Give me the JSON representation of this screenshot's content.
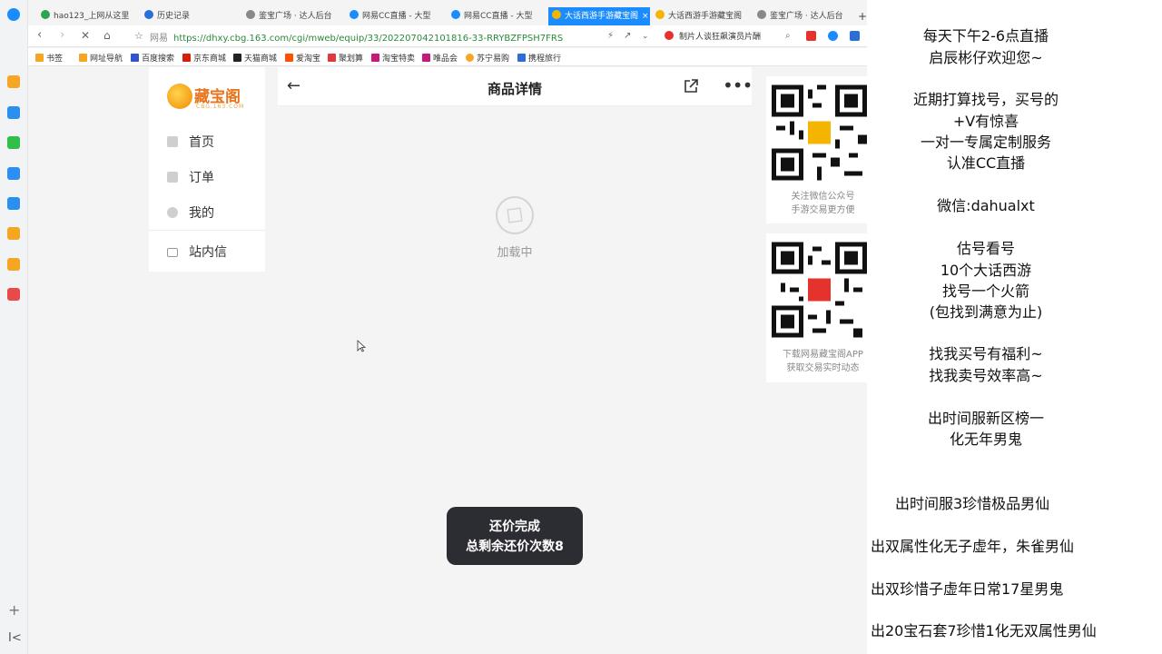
{
  "tabs": [
    {
      "title": "hao123_上网从这里",
      "icon_color": "#2ea44f"
    },
    {
      "title": "历史记录",
      "icon_color": "#2b6fd6"
    },
    {
      "title": "鉴宝广场 · 达人后台",
      "icon_color": "#666666"
    },
    {
      "title": "网易CC直播 - 大型",
      "icon_color": "#1a8cff"
    },
    {
      "title": "网易CC直播 - 大型",
      "icon_color": "#1a8cff"
    },
    {
      "title": "大话西游手游藏宝阁",
      "icon_color": "#f5b400",
      "active": true,
      "close": "×"
    },
    {
      "title": "大话西游手游藏宝阁",
      "icon_color": "#f5b400"
    },
    {
      "title": "鉴宝广场 · 达人后台",
      "icon_color": "#666666"
    },
    {
      "title": "+"
    }
  ],
  "address": {
    "site": "网易",
    "url": "https://dhxy.cbg.163.com/cgi/mweb/equip/33/202207042101816-33-RRYBZFPSH7FRS",
    "right_text": "制片人谈狂飙演员片酬"
  },
  "bookmarks": [
    {
      "label": "书签",
      "icon_color": "#f5a623"
    },
    {
      "label": "网址导航",
      "icon_color": "#f5a623"
    },
    {
      "label": "百度搜索",
      "icon_color": "#3355cc"
    },
    {
      "label": "京东商城",
      "icon_color": "#d81e06"
    },
    {
      "label": "天猫商城",
      "icon_color": "#222222"
    },
    {
      "label": "爱淘宝",
      "icon_color": "#ff5000"
    },
    {
      "label": "聚划算",
      "icon_color": "#e4393c"
    },
    {
      "label": "淘宝特卖",
      "icon_color": "#c7197b"
    },
    {
      "label": "唯品会",
      "icon_color": "#c7197b"
    },
    {
      "label": "苏宁易购",
      "icon_color": "#f5a623"
    },
    {
      "label": "携程旅行",
      "icon_color": "#2b6fd6"
    }
  ],
  "sidebar": {
    "logo_text": "藏宝阁",
    "logo_sub": "CBG.163.COM",
    "items": [
      {
        "label": "首页",
        "icon": "home-icon"
      },
      {
        "label": "订单",
        "icon": "order-icon"
      },
      {
        "label": "我的",
        "icon": "user-icon"
      },
      {
        "label": "站内信",
        "icon": "mail-icon"
      }
    ]
  },
  "content": {
    "back": "←",
    "title": "商品详情",
    "more": "•••",
    "loading": "加载中"
  },
  "toast": {
    "line1": "还价完成",
    "line2": "总剩余还价次数8"
  },
  "qr": [
    {
      "caption1": "关注微信公众号",
      "caption2": "手游交易更方便"
    },
    {
      "caption1": "下载网易藏宝阁APP",
      "caption2": "获取交易实时动态"
    }
  ],
  "side_panel": {
    "lines": [
      "每天下午2-6点直播",
      "启辰彬仔欢迎您~",
      "近期打算找号，买号的",
      "+V有惊喜",
      "一对一专属定制服务",
      "认准CC直播",
      "微信:dahualxt",
      "估号看号",
      "10个大话西游",
      "找号一个火箭",
      "(包找到满意为止)",
      "找我买号有福利~",
      "找我卖号效率高~",
      "出时间服新区榜一",
      "化无年男鬼",
      "出时间服3珍惜极品男仙",
      "出双属性化无子虚年，朱雀男仙",
      "出双珍惜子虚年日常17星男鬼",
      "出20宝石套7珍惜1化无双属性男仙"
    ]
  }
}
